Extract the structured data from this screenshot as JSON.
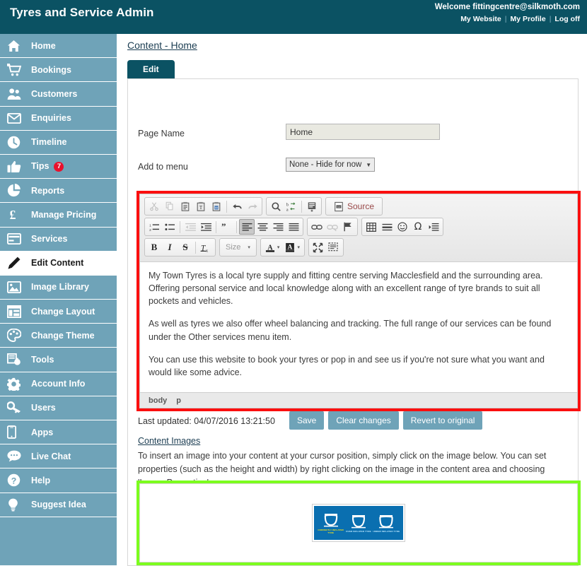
{
  "header": {
    "app_title": "Tyres and Service Admin",
    "welcome": "Welcome fittingcentre@silkmoth.com",
    "links": [
      {
        "label": "My Website"
      },
      {
        "label": "My Profile"
      },
      {
        "label": "Log off"
      }
    ],
    "separator": "|",
    "bg_color": "#0b5263"
  },
  "sidebar": {
    "bg_color": "#6fa3b8",
    "active_index": 9,
    "items": [
      {
        "label": "Home",
        "icon": "home-icon"
      },
      {
        "label": "Bookings",
        "icon": "cart-icon"
      },
      {
        "label": "Customers",
        "icon": "users-icon"
      },
      {
        "label": "Enquiries",
        "icon": "envelope-icon"
      },
      {
        "label": "Timeline",
        "icon": "clock-icon"
      },
      {
        "label": "Tips",
        "icon": "thumbs-up-icon",
        "badge": "7",
        "badge_color": "#e8112d"
      },
      {
        "label": "Reports",
        "icon": "pie-chart-icon"
      },
      {
        "label": "Manage Pricing",
        "icon": "pound-icon"
      },
      {
        "label": "Services",
        "icon": "card-icon"
      },
      {
        "label": "Edit Content",
        "icon": "pencil-icon"
      },
      {
        "label": "Image Library",
        "icon": "photo-icon"
      },
      {
        "label": "Change Layout",
        "icon": "layout-icon"
      },
      {
        "label": "Change Theme",
        "icon": "palette-icon"
      },
      {
        "label": "Tools",
        "icon": "tools-icon"
      },
      {
        "label": "Account Info",
        "icon": "gear-icon"
      },
      {
        "label": "Users",
        "icon": "key-icon"
      },
      {
        "label": "Apps",
        "icon": "mobile-icon"
      },
      {
        "label": "Live Chat",
        "icon": "chat-bubble-icon"
      },
      {
        "label": "Help",
        "icon": "question-circle-icon"
      },
      {
        "label": "Suggest Idea",
        "icon": "lightbulb-icon"
      }
    ]
  },
  "main": {
    "breadcrumb": "Content - Home",
    "tab": {
      "label": "Edit",
      "active": true
    },
    "form": {
      "page_name_label": "Page Name",
      "page_name_value": "Home",
      "page_name_placeholder": "Page Name",
      "add_to_menu_label": "Add to menu",
      "add_to_menu_value": "None - Hide for now",
      "add_to_menu_caret": "▼"
    },
    "editor": {
      "highlight_color": "#fb0f0f",
      "toolbar_rows": [
        {
          "groups": [
            {
              "buttons": [
                {
                  "icon": "cut-icon",
                  "name": "cut-button",
                  "state": "dim"
                },
                {
                  "icon": "copy-icon",
                  "name": "copy-button",
                  "state": "dim"
                },
                {
                  "icon": "paste-icon",
                  "name": "paste-button",
                  "state": "normal"
                },
                {
                  "icon": "paste-text-icon",
                  "name": "paste-as-plain-text-button",
                  "state": "normal"
                },
                {
                  "icon": "paste-word-icon",
                  "name": "paste-from-word-button",
                  "state": "normal"
                },
                {
                  "icon": "separator",
                  "name": "toolbar-separator",
                  "state": "sep"
                },
                {
                  "icon": "undo-icon",
                  "name": "undo-button",
                  "state": "normal"
                },
                {
                  "icon": "redo-icon",
                  "name": "redo-button",
                  "state": "dim"
                }
              ]
            },
            {
              "buttons": [
                {
                  "icon": "search-icon",
                  "name": "find-button",
                  "state": "normal"
                },
                {
                  "icon": "replace-icon",
                  "name": "replace-button",
                  "state": "normal"
                },
                {
                  "icon": "separator",
                  "name": "toolbar-separator",
                  "state": "sep"
                },
                {
                  "icon": "select-all-icon",
                  "name": "select-all-button",
                  "state": "normal"
                }
              ]
            },
            {
              "buttons": [
                {
                  "icon": "source-icon",
                  "name": "source-button",
                  "state": "normal",
                  "label": "Source"
                }
              ]
            }
          ]
        },
        {
          "groups": [
            {
              "buttons": [
                {
                  "icon": "numbered-list-icon",
                  "name": "insert-numbered-list-button",
                  "state": "normal"
                },
                {
                  "icon": "bulleted-list-icon",
                  "name": "insert-bulleted-list-button",
                  "state": "normal"
                },
                {
                  "icon": "separator",
                  "name": "toolbar-separator",
                  "state": "sep"
                },
                {
                  "icon": "outdent-icon",
                  "name": "decrease-indent-button",
                  "state": "dim"
                },
                {
                  "icon": "indent-icon",
                  "name": "increase-indent-button",
                  "state": "normal"
                },
                {
                  "icon": "separator",
                  "name": "toolbar-separator",
                  "state": "sep"
                },
                {
                  "icon": "blockquote-icon",
                  "name": "block-quote-button",
                  "state": "normal"
                },
                {
                  "icon": "separator",
                  "name": "toolbar-separator",
                  "state": "sep"
                },
                {
                  "icon": "align-left-icon",
                  "name": "align-left-button",
                  "state": "on"
                },
                {
                  "icon": "align-center-icon",
                  "name": "align-center-button",
                  "state": "normal"
                },
                {
                  "icon": "align-right-icon",
                  "name": "align-right-button",
                  "state": "normal"
                },
                {
                  "icon": "align-justify-icon",
                  "name": "align-justify-button",
                  "state": "normal"
                }
              ]
            },
            {
              "buttons": [
                {
                  "icon": "link-icon",
                  "name": "insert-link-button",
                  "state": "normal"
                },
                {
                  "icon": "unlink-icon",
                  "name": "remove-link-button",
                  "state": "dim"
                },
                {
                  "icon": "anchor-icon",
                  "name": "insert-anchor-button",
                  "state": "normal"
                }
              ]
            },
            {
              "buttons": [
                {
                  "icon": "table-icon",
                  "name": "insert-table-button",
                  "state": "normal"
                },
                {
                  "icon": "horizontal-rule-icon",
                  "name": "insert-horizontal-line-button",
                  "state": "normal"
                },
                {
                  "icon": "smiley-icon",
                  "name": "insert-smiley-button",
                  "state": "normal"
                },
                {
                  "icon": "omega-icon",
                  "name": "insert-special-character-button",
                  "state": "normal",
                  "label": "Ω"
                },
                {
                  "icon": "page-break-icon",
                  "name": "insert-page-break-button",
                  "state": "normal"
                }
              ]
            }
          ]
        },
        {
          "groups": [
            {
              "buttons": [
                {
                  "icon": "bold-icon",
                  "name": "bold-button",
                  "state": "normal",
                  "label": "B"
                },
                {
                  "icon": "italic-icon",
                  "name": "italic-button",
                  "state": "normal",
                  "label": "I"
                },
                {
                  "icon": "strikethrough-icon",
                  "name": "strikethrough-button",
                  "state": "normal",
                  "label": "S"
                },
                {
                  "icon": "separator",
                  "name": "toolbar-separator",
                  "state": "sep"
                },
                {
                  "icon": "remove-format-icon",
                  "name": "remove-format-button",
                  "state": "normal"
                }
              ]
            },
            {
              "buttons": [
                {
                  "icon": "size-dropdown-icon",
                  "name": "font-size-dropdown",
                  "state": "normal",
                  "label": "Size",
                  "caret": "▾"
                }
              ]
            },
            {
              "buttons": [
                {
                  "icon": "text-color-icon",
                  "name": "text-color-button",
                  "state": "normal",
                  "label": "A",
                  "caret": "▾"
                },
                {
                  "icon": "background-color-icon",
                  "name": "background-color-button",
                  "state": "normal",
                  "label": "A",
                  "caret": "▾"
                }
              ]
            },
            {
              "buttons": [
                {
                  "icon": "maximize-icon",
                  "name": "maximize-button",
                  "state": "normal"
                },
                {
                  "icon": "show-blocks-icon",
                  "name": "show-blocks-button",
                  "state": "normal"
                }
              ]
            }
          ]
        }
      ],
      "body_paragraphs": [
        "My Town Tyres is a local tyre supply and fitting centre serving Macclesfield and the surrounding area. Offering personal service and local knowledge along with an excellent range of tyre brands to suit all pockets and vehicles.",
        "As well as tyres we also offer wheel balancing and tracking. The full range of our services can be found under the Other services menu item.",
        "You can use this website to book your tyres or pop in and see us if you're not sure what you want and would like some advice."
      ],
      "status_path": [
        "body",
        "p"
      ]
    },
    "actions": {
      "last_updated": "Last updated: 04/07/2016 13:21:50",
      "save_label": "Save",
      "clear_label": "Clear changes",
      "revert_label": "Revert to original",
      "button_color": "#6fa3b8"
    },
    "content_images": {
      "title": "Content Images",
      "description": "To insert an image into your content at your cursor position, simply click on the image below. You can set properties (such as the height and width) by right clicking on the image in the content area and choosing 'Image Properties'.",
      "highlight_color": "#7cfc1e",
      "thumbnail": {
        "name": "tyre-inflation-diagram",
        "bg_color": "#0a6fb0",
        "cells": [
          {
            "caption": "CORRECTLY INFLATED TYRE",
            "state": "correct"
          },
          {
            "caption": "OVER INFLATED TYRE",
            "state": "over"
          },
          {
            "caption": "UNDER INFLATED TYRE",
            "state": "under"
          }
        ]
      }
    }
  }
}
